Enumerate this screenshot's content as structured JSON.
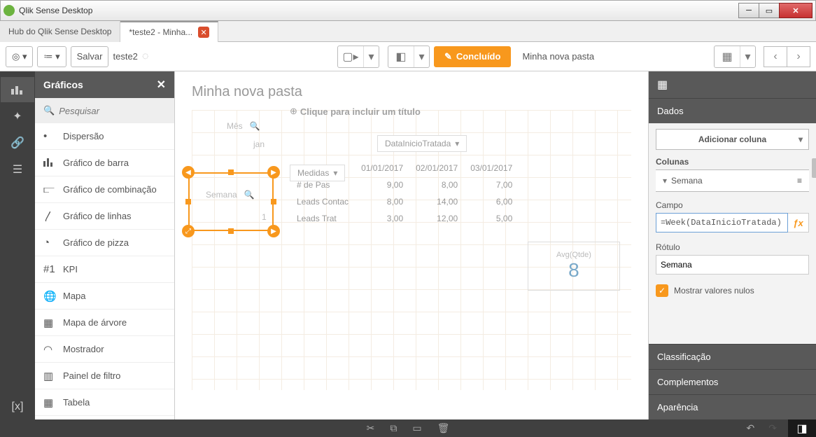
{
  "window": {
    "title": "Qlik Sense Desktop"
  },
  "tabs": [
    {
      "label": "Hub do Qlik Sense Desktop"
    },
    {
      "label": "*teste2 - Minha..."
    }
  ],
  "toolbar": {
    "save": "Salvar",
    "doc_name": "teste2",
    "done": "Concluído",
    "sheet_name": "Minha nova pasta"
  },
  "asset": {
    "header": "Gráficos",
    "search_placeholder": "Pesquisar",
    "items": [
      "Dispersão",
      "Gráfico de barra",
      "Gráfico de combinação",
      "Gráfico de linhas",
      "Gráfico de pizza",
      "KPI",
      "Mapa",
      "Mapa de árvore",
      "Mostrador",
      "Painel de filtro",
      "Tabela"
    ]
  },
  "icons": {
    "assets": [
      "•",
      "▮",
      "≋",
      "〳",
      "◔",
      "#1",
      "◉",
      "▦",
      "◔",
      "▥",
      "▦"
    ]
  },
  "canvas": {
    "sheet_title": "Minha nova pasta",
    "placeholder_title": "Clique para incluir um título",
    "pivot_dim1": "Mês",
    "pivot_dim1_val": "jan",
    "pivot_dim2": "Semana",
    "pivot_dim2_val": "1",
    "drop_datefield": "DataInicioTratada",
    "drop_measures": "Medidas",
    "dates": [
      "01/01/2017",
      "02/01/2017",
      "03/01/2017"
    ],
    "rows": [
      {
        "label": "# de Pas",
        "v": [
          "9,00",
          "8,00",
          "7,00"
        ]
      },
      {
        "label": "Leads Contac",
        "v": [
          "8,00",
          "14,00",
          "6,00"
        ]
      },
      {
        "label": "Leads Trat",
        "v": [
          "3,00",
          "12,00",
          "5,00"
        ]
      }
    ],
    "kpi_label": "Avg(Qtde)",
    "kpi_value": "8"
  },
  "props": {
    "section_data": "Dados",
    "add_column": "Adicionar coluna",
    "columns_heading": "Colunas",
    "col_name": "Semana",
    "field_label": "Campo",
    "field_value": "=Week(DataInicioTratada)",
    "rot_label": "Rótulo",
    "rot_value": "Semana",
    "show_nulls": "Mostrar valores nulos",
    "section_class": "Classificação",
    "section_comp": "Complementos",
    "section_app": "Aparência"
  }
}
